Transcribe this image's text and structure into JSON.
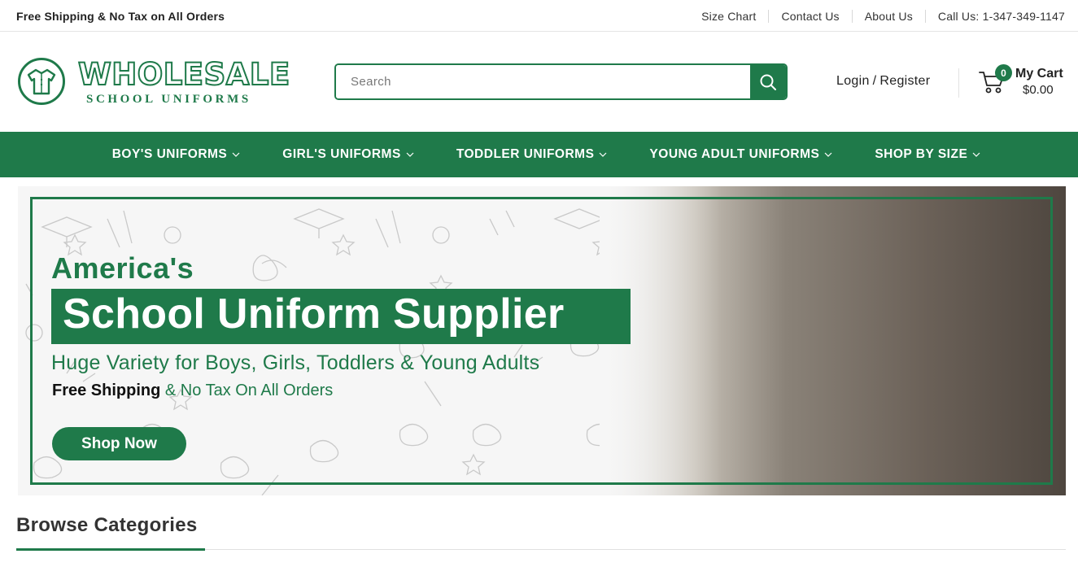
{
  "topbar": {
    "promo": "Free Shipping & No Tax on All Orders",
    "links": [
      "Size Chart",
      "Contact Us",
      "About Us",
      "Call Us: 1-347-349-1147"
    ]
  },
  "header": {
    "logo_word": "WHOLESALE",
    "logo_sub": "SCHOOL UNIFORMS",
    "search": {
      "placeholder": "Search",
      "value": ""
    },
    "login_label": "Login",
    "register_label": "Register",
    "login_separator": "/",
    "cart": {
      "label": "My Cart",
      "count": "0",
      "total": "$0.00"
    }
  },
  "nav": {
    "items": [
      {
        "label": "BOY'S UNIFORMS"
      },
      {
        "label": "GIRL'S UNIFORMS"
      },
      {
        "label": "TODDLER UNIFORMS"
      },
      {
        "label": "YOUNG ADULT UNIFORMS"
      },
      {
        "label": "SHOP BY SIZE"
      }
    ]
  },
  "hero": {
    "line1": "America's",
    "line2": "School Uniform Supplier",
    "line3": "Huge Variety for Boys, Girls, Toddlers & Young Adults",
    "line4_bold": "Free Shipping",
    "line4_rest": "& No Tax On All Orders",
    "button": "Shop Now"
  },
  "browse": {
    "title": "Browse Categories"
  },
  "colors": {
    "brand_green": "#1f7a4a",
    "text_dark": "#222222"
  }
}
